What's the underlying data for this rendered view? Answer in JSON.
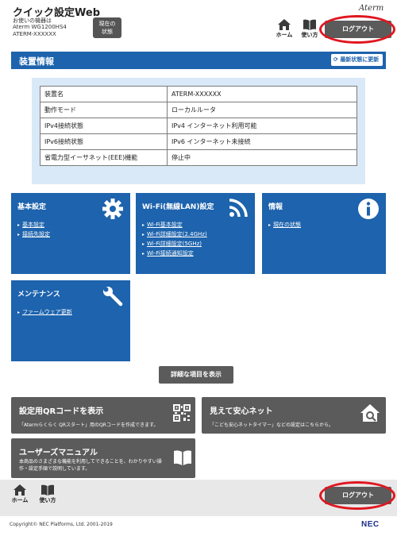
{
  "header": {
    "title": "クイック設定Web",
    "device_label": "お使いの機器は",
    "device_model": "Aterm WG1200HS4",
    "device_name": "ATERM-XXXXXX",
    "status_btn_line1": "現在の",
    "status_btn_line2": "状態",
    "brand": "Aterm",
    "home_label": "ホーム",
    "help_label": "使い方",
    "logout_label": "ログアウト"
  },
  "section": {
    "title": "装置情報",
    "refresh_label": "最新状態に更新"
  },
  "info_table": [
    {
      "key": "装置名",
      "value": "ATERM-XXXXXX"
    },
    {
      "key": "動作モード",
      "value": "ローカルルータ"
    },
    {
      "key": "IPv4接続状態",
      "value": "IPv4 インターネット利用可能"
    },
    {
      "key": "IPv6接続状態",
      "value": "IPv6 インターネット未接続"
    },
    {
      "key": "省電力型イーサネット(EEE)機能",
      "value": "停止中"
    }
  ],
  "tiles": {
    "basic": {
      "title": "基本設定",
      "icon": "gear-icon",
      "links": [
        "基本設定",
        "接続先設定"
      ]
    },
    "wifi": {
      "title": "Wi-Fi(無線LAN)設定",
      "icon": "wifi-icon",
      "links": [
        "Wi-Fi基本設定",
        "Wi-Fi詳細設定(2.4GHz)",
        "Wi-Fi詳細設定(5GHz)",
        "Wi-Fi接続通知設定"
      ]
    },
    "info": {
      "title": "情報",
      "icon": "info-icon",
      "links": [
        "現在の状態"
      ]
    },
    "maint": {
      "title": "メンテナンス",
      "icon": "wrench-icon",
      "links": [
        "ファームウェア更新"
      ]
    }
  },
  "detail_button": "詳細な項目を表示",
  "cards": {
    "qr": {
      "title": "設定用QRコードを表示",
      "desc": "「Atermらくらく QRスタート」用のQRコードを作成できます。",
      "icon": "qr-code-icon"
    },
    "safety": {
      "title": "見えて安心ネット",
      "desc": "「こども安心ネットタイマー」などの設定はこちらから。",
      "icon": "home-search-icon"
    },
    "manual": {
      "title": "ユーザーズマニュアル",
      "desc1": "本商品のさまざまな機能を利用してできることを、わかりやすい操",
      "desc2": "作・設定手順で説明しています。",
      "icon": "book-icon"
    }
  },
  "footer": {
    "home_label": "ホーム",
    "help_label": "使い方",
    "logout_label": "ログアウト",
    "copyright": "Copyright© NEC Platforms, Ltd. 2001-2019",
    "brand": "NEC"
  },
  "colors": {
    "accent": "#1d63ad",
    "panel": "#d9e9f7",
    "button_gray": "#5b5b5b",
    "highlight": "#e0161f"
  }
}
